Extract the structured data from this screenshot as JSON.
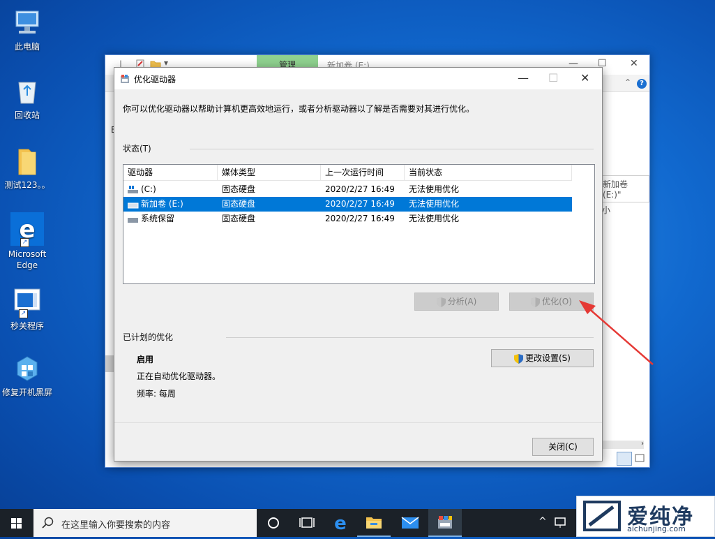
{
  "desktop": {
    "icons": [
      {
        "label": "此电脑",
        "icon": "computer-icon"
      },
      {
        "label": "回收站",
        "icon": "recycle-bin-icon"
      },
      {
        "label": "测试123。。",
        "icon": "folder-icon"
      },
      {
        "label": "Microsoft Edge",
        "icon": "edge-icon"
      },
      {
        "label": "秒关程序",
        "icon": "app-window-icon"
      },
      {
        "label": "修复开机黑屏",
        "icon": "repair-tool-icon"
      }
    ]
  },
  "explorer": {
    "manage_tab": "管理",
    "title": "新加卷 (E:)",
    "side_address": "新加卷 (E:)\"",
    "side_col": "小",
    "left_letter": "E"
  },
  "dialog": {
    "title": "优化驱动器",
    "description": "你可以优化驱动器以帮助计算机更高效地运行，或者分析驱动器以了解是否需要对其进行优化。",
    "status_label": "状态(T)",
    "columns": [
      "驱动器",
      "媒体类型",
      "上一次运行时间",
      "当前状态"
    ],
    "rows": [
      {
        "drive": "(C:)",
        "media": "固态硬盘",
        "last_run": "2020/2/27 16:49",
        "status": "无法使用优化"
      },
      {
        "drive": "新加卷 (E:)",
        "media": "固态硬盘",
        "last_run": "2020/2/27 16:49",
        "status": "无法使用优化"
      },
      {
        "drive": "系统保留",
        "media": "固态硬盘",
        "last_run": "2020/2/27 16:49",
        "status": "无法使用优化"
      }
    ],
    "selected_row": 1,
    "analyze_button": "分析(A)",
    "optimize_button": "优化(O)",
    "scheduled_label": "已计划的优化",
    "schedule_state": "启用",
    "schedule_desc": "正在自动优化驱动器。",
    "frequency": "频率: 每周",
    "change_settings_button": "更改设置(S)",
    "close_button": "关闭(C)"
  },
  "taskbar": {
    "search_placeholder": "在这里输入你要搜索的内容"
  },
  "watermark": {
    "brand": "爱纯净",
    "url": "aichunjing.com"
  },
  "colors": {
    "selection": "#0078d7",
    "arrow": "#e53935",
    "manage_tab": "#8fd18f"
  }
}
